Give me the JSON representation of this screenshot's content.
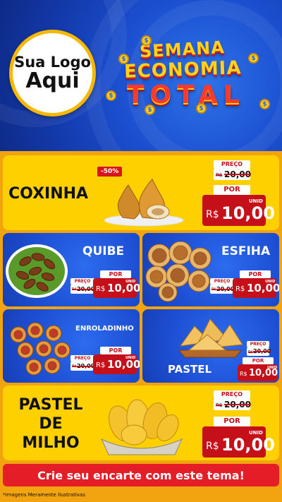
{
  "header": {
    "logo": {
      "line1": "Sua Logo",
      "line2": "Aqui"
    },
    "title": {
      "word1": "SEMANA",
      "word2": "ECONOMIA",
      "word3": "TOTAL"
    },
    "coin_symbol": "$"
  },
  "products": {
    "coxinha": {
      "name": "COXINHA",
      "discount": "-50%",
      "preco_label": "PREÇO",
      "old_currency": "R$",
      "old_price": "20,00",
      "por_label": "POR",
      "currency": "R$",
      "price": "10,00",
      "unit": "UNID"
    },
    "quibe": {
      "name": "QUIBE",
      "preco_label": "PREÇO",
      "old_currency": "R$",
      "old_price": "20,00",
      "por_label": "POR",
      "currency": "R$",
      "price": "10,00",
      "unit": "UNID"
    },
    "esfiha": {
      "name": "ESFIHA",
      "preco_label": "PREÇO",
      "old_currency": "R$",
      "old_price": "20,00",
      "por_label": "POR",
      "currency": "R$",
      "price": "10,00",
      "unit": "UNID"
    },
    "enroladinho": {
      "name": "ENROLADINHO",
      "preco_label": "PREÇO",
      "old_currency": "R$",
      "old_price": "20,00",
      "por_label": "POR",
      "currency": "R$",
      "price": "10,00",
      "unit": "UNID"
    },
    "pastel": {
      "name": "PASTEL",
      "preco_label": "PREÇO",
      "old_currency": "R$",
      "old_price": "20,00",
      "por_label": "POR",
      "currency": "R$",
      "price": "10,00",
      "unit": "UNID"
    },
    "pastel_milho": {
      "name_line1": "PASTEL",
      "name_line2": "DE",
      "name_line3": "MILHO",
      "preco_label": "PREÇO",
      "old_currency": "R$",
      "old_price": "20,00",
      "por_label": "POR",
      "currency": "R$",
      "price": "10,00",
      "unit": "UNID"
    }
  },
  "cta": {
    "label": "Crie seu encarte com este tema!"
  },
  "footnote": "*Imagens Meramente Ilustrativas",
  "colors": {
    "header_blue": "#1b4fd0",
    "panel_yellow": "#ffd000",
    "price_red": "#c5101a",
    "cta_red": "#e51d26",
    "background_orange": "#f4a40c"
  }
}
